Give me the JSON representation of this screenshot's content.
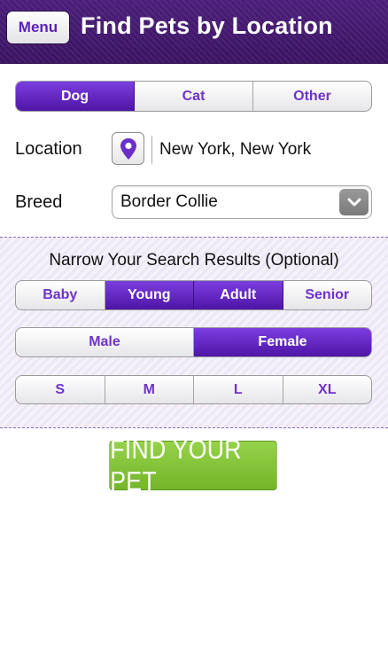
{
  "header": {
    "menu_label": "Menu",
    "title": "Find Pets by Location"
  },
  "pet_types": {
    "options": [
      "Dog",
      "Cat",
      "Other"
    ],
    "selected": "Dog"
  },
  "location": {
    "label": "Location",
    "value": "New York, New York",
    "icon": "location-pin-icon"
  },
  "breed": {
    "label": "Breed",
    "value": "Border Collie",
    "icon": "chevron-down-icon"
  },
  "narrow": {
    "title": "Narrow Your Search Results (Optional)",
    "ages": {
      "options": [
        "Baby",
        "Young",
        "Adult",
        "Senior"
      ],
      "selected": [
        "Young",
        "Adult"
      ]
    },
    "genders": {
      "options": [
        "Male",
        "Female"
      ],
      "selected": [
        "Female"
      ]
    },
    "sizes": {
      "options": [
        "S",
        "M",
        "L",
        "XL"
      ],
      "selected": []
    }
  },
  "find_button": {
    "label": "FIND YOUR PET"
  },
  "colors": {
    "accent": "#5a21b6",
    "selected": "#6328c5",
    "header": "#3f1868",
    "find": "#84c43a"
  }
}
